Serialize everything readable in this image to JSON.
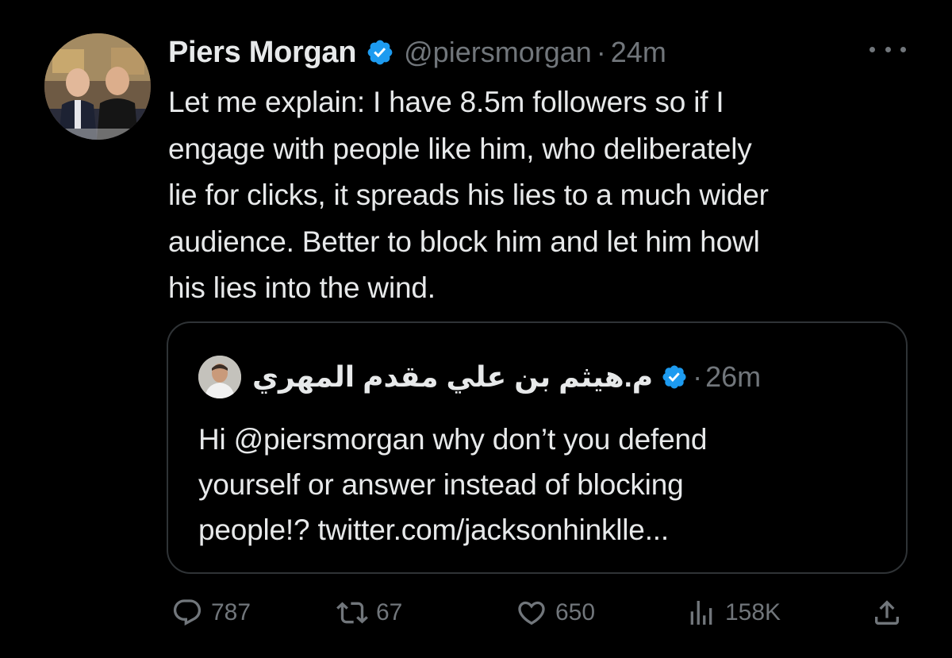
{
  "tweet": {
    "author_name": "Piers Morgan",
    "handle": "@piersmorgan",
    "separator": "·",
    "time": "24m",
    "text": "Let me explain: I have 8.5m followers so if I\nengage with people like him, who deliberately\nlie for clicks, it spreads his lies to a much wider\naudience. Better to block him and let him howl\nhis lies into the wind.",
    "icons": {
      "verified": "verified-badge-icon",
      "more": "more-options-icon"
    },
    "accent_color": "#1d9bf0"
  },
  "quote": {
    "author_name": "م.هيثم بن علي مقدم المهري",
    "separator": "·",
    "time": "26m",
    "text": "Hi @piersmorgan why don’t you defend\nyourself or answer instead of blocking\npeople!? twitter.com/jacksonhinklle..."
  },
  "actions": {
    "reply_count": "787",
    "retweet_count": "67",
    "like_count": "650",
    "views_count": "158K"
  }
}
